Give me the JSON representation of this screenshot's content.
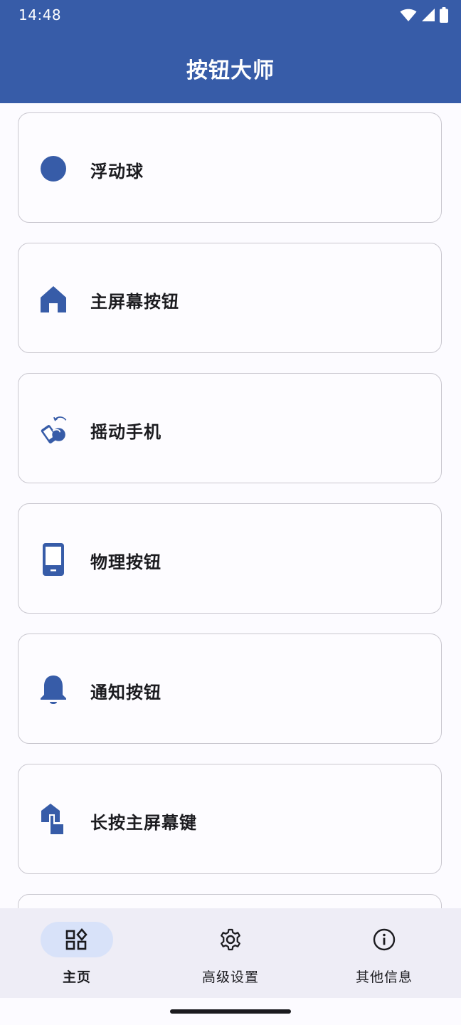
{
  "status_bar": {
    "time": "14:48",
    "icons": [
      "wifi-icon",
      "signal-icon",
      "battery-icon"
    ]
  },
  "app_bar": {
    "title": "按钮大师"
  },
  "colors": {
    "primary": "#375ca8",
    "nav_active_pill": "#d8e2f9",
    "nav_background": "#eeedf6",
    "card_border": "#c9c7cf"
  },
  "cards": [
    {
      "label": "浮动球",
      "icon": "floating-ball-icon"
    },
    {
      "label": "主屏幕按钮",
      "icon": "home-icon"
    },
    {
      "label": "摇动手机",
      "icon": "shake-phone-icon"
    },
    {
      "label": "物理按钮",
      "icon": "phone-device-icon"
    },
    {
      "label": "通知按钮",
      "icon": "bell-icon"
    },
    {
      "label": "长按主屏幕键",
      "icon": "long-press-home-icon"
    }
  ],
  "bottom_nav": {
    "items": [
      {
        "label": "主页",
        "icon": "dashboard-icon",
        "active": true
      },
      {
        "label": "高级设置",
        "icon": "gear-icon",
        "active": false
      },
      {
        "label": "其他信息",
        "icon": "info-icon",
        "active": false
      }
    ]
  }
}
